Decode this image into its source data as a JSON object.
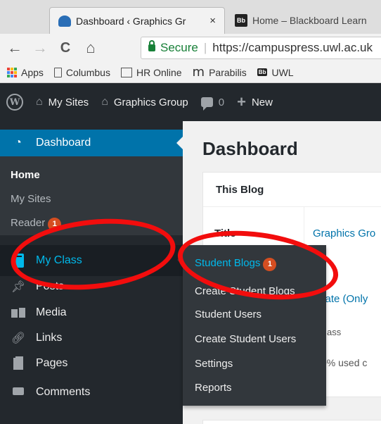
{
  "browser": {
    "tabs": [
      {
        "title": "Dashboard ‹ Graphics Gr",
        "active": true,
        "close": "×"
      },
      {
        "title": "Home – Blackboard Learn",
        "active": false,
        "favicon_text": "Bb"
      }
    ],
    "nav": {
      "back": "←",
      "forward": "→",
      "reload": "C",
      "home": "⌂"
    },
    "address": {
      "secure_label": "Secure",
      "url": "https://campuspress.uwl.ac.uk"
    },
    "bookmarks": [
      {
        "label": "Apps",
        "icon": "apps-grid-icon"
      },
      {
        "label": "Columbus",
        "icon": "page-icon"
      },
      {
        "label": "HR Online",
        "icon": "hr-online-icon"
      },
      {
        "label": "Parabilis",
        "icon": "m-logo-icon",
        "glyph": "m"
      },
      {
        "label": "UWL",
        "icon": "blackboard-icon",
        "badge": "Bb"
      }
    ]
  },
  "adminbar": {
    "wp_logo": "W",
    "my_sites": "My Sites",
    "site_name": "Graphics Group",
    "comments_count": "0",
    "new_label": "New",
    "plus": "+"
  },
  "sidebar": {
    "dashboard": "Dashboard",
    "submenu": {
      "home": "Home",
      "my_sites": "My Sites",
      "reader": "Reader",
      "reader_badge": "1"
    },
    "my_class": "My Class",
    "items": [
      "Posts",
      "Media",
      "Links",
      "Pages",
      "Comments"
    ]
  },
  "flyout": {
    "student_blogs": "Student Blogs",
    "student_blogs_badge": "1",
    "items": [
      "Create Student Blogs",
      "Student Users",
      "Create Student Users",
      "Settings",
      "Reports"
    ]
  },
  "main": {
    "page_title": "Dashboard",
    "box_title": "This Blog",
    "row_title_label": "Title",
    "blog_name": "Graphics Gro",
    "privacy": "vate (Only",
    "class_text": "ass",
    "usage_text": "0% used c"
  },
  "colors": {
    "annotation": "#f20d0d",
    "wp_blue": "#0073aa",
    "adminbar": "#23282d",
    "badge": "#d54e21"
  }
}
